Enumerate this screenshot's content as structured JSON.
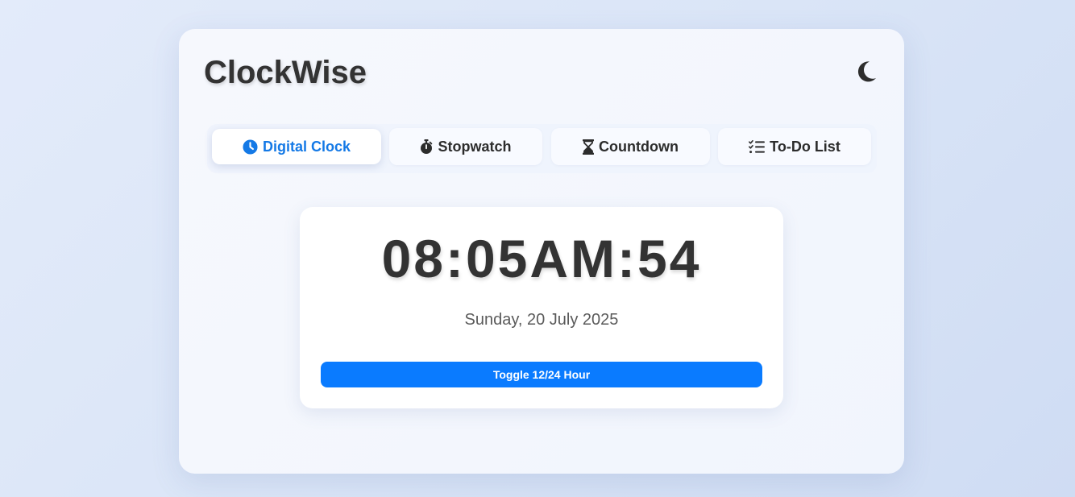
{
  "app": {
    "title": "ClockWise",
    "theme_toggle_icon": "moon-icon"
  },
  "tabs": [
    {
      "label": "Digital Clock",
      "icon": "clock-icon",
      "active": true
    },
    {
      "label": "Stopwatch",
      "icon": "stopwatch-icon",
      "active": false
    },
    {
      "label": "Countdown",
      "icon": "hourglass-icon",
      "active": false
    },
    {
      "label": "To-Do List",
      "icon": "checklist-icon",
      "active": false
    }
  ],
  "clock": {
    "time": "08:05AM:54",
    "date": "Sunday, 20 July 2025",
    "toggle_label": "Toggle 12/24 Hour"
  },
  "colors": {
    "accent": "#0a7bff",
    "active_tab_text": "#1479e6",
    "text_dark": "#333333",
    "text_muted": "#5a5a5a"
  }
}
